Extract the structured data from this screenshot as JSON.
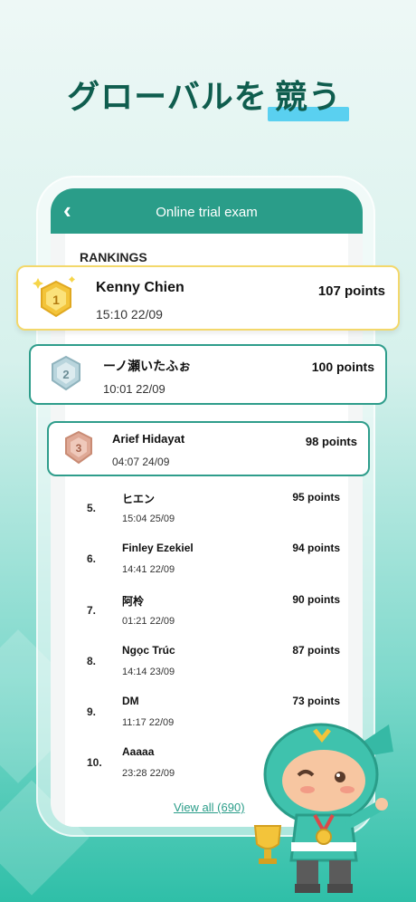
{
  "headline": {
    "prefix": "グローバルを",
    "highlight": "競う"
  },
  "appbar": {
    "back_icon": "chevron-left-icon",
    "title": "Online trial exam"
  },
  "rankings_label": "RANKINGS",
  "podium": [
    {
      "rank": "1",
      "name": "Kenny Chien",
      "time": "15:10 22/09",
      "points": "107 points"
    },
    {
      "rank": "2",
      "name": "ーノ瀬いたふぉ",
      "time": "10:01 22/09",
      "points": "100 points"
    },
    {
      "rank": "3",
      "name": "Arief Hidayat",
      "time": "04:07 24/09",
      "points": "98 points"
    }
  ],
  "list": [
    {
      "rank": "5.",
      "name": "ヒエン",
      "time": "15:04 25/09",
      "points": "95 points"
    },
    {
      "rank": "6.",
      "name": "Finley Ezekiel",
      "time": "14:41 22/09",
      "points": "94 points"
    },
    {
      "rank": "7.",
      "name": "阿柃",
      "time": "01:21 22/09",
      "points": "90 points"
    },
    {
      "rank": "8.",
      "name": "Ngọc Trúc",
      "time": "14:14 23/09",
      "points": "87 points"
    },
    {
      "rank": "9.",
      "name": "DM",
      "time": "11:17 22/09",
      "points": "73 points"
    },
    {
      "rank": "10.",
      "name": "Aaaaa",
      "time": "23:28 22/09",
      "points": ""
    }
  ],
  "view_all": "View all (690)",
  "colors": {
    "primary": "#2a9d89",
    "gold": "#f3c43a",
    "silver": "#a9c9d3",
    "bronze": "#d89a86"
  }
}
